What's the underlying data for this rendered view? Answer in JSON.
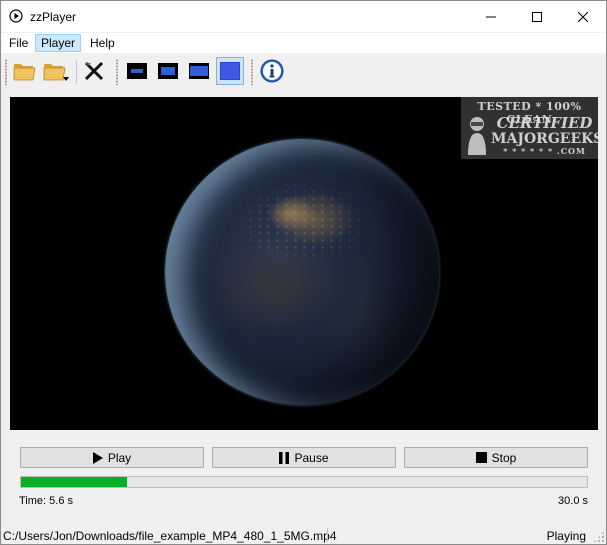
{
  "window": {
    "title": "zzPlayer"
  },
  "menu": {
    "items": [
      {
        "label": "File"
      },
      {
        "label": "Player"
      },
      {
        "label": "Help"
      }
    ]
  },
  "toolbar": {
    "buttons": [
      {
        "icon": "open-folder-icon"
      },
      {
        "icon": "open-recent-folder-icon"
      },
      {
        "icon": "close-file-icon"
      },
      {
        "icon": "view-small-icon"
      },
      {
        "icon": "view-medium-icon"
      },
      {
        "icon": "view-large-icon"
      },
      {
        "icon": "view-full-icon",
        "active": true
      },
      {
        "icon": "info-icon"
      }
    ]
  },
  "watermark": {
    "line1": "TESTED * 100% CLEAN",
    "line2": "CERTIFIED",
    "line3": "MAJORGEEKS",
    "line4": "* * * * * * .COM"
  },
  "controls": {
    "play_label": "Play",
    "pause_label": "Pause",
    "stop_label": "Stop"
  },
  "playback": {
    "progress": 0.1867,
    "current_time": "Time: 5.6 s",
    "total_time": "30.0 s",
    "progress_color": "#06b025"
  },
  "status": {
    "path": "C:/Users/Jon/Downloads/file_example_MP4_480_1_5MG.mp4",
    "state": "Playing"
  }
}
